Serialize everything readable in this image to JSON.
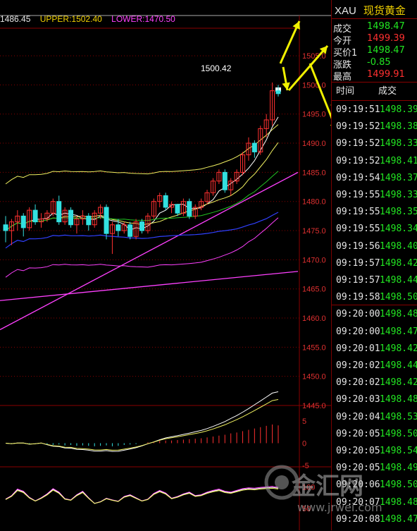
{
  "symbol": {
    "code": "XAU",
    "name": "现货黄金"
  },
  "indicators_bar": {
    "mid": "1486.45",
    "upper": "UPPER:1502.40",
    "lower": "LOWER:1470.50"
  },
  "quote": [
    {
      "label": "成交",
      "value": "1498.47",
      "color": "#22e622"
    },
    {
      "label": "今开",
      "value": "1499.39",
      "color": "#ff3030"
    },
    {
      "label": "买价1",
      "value": "1498.47",
      "color": "#22e622"
    },
    {
      "label": "涨跌",
      "value": "-0.85",
      "color": "#22e622"
    },
    {
      "label": "最高",
      "value": "1499.91",
      "color": "#ff3030"
    }
  ],
  "ticks_header": {
    "time": "时间",
    "price": "成交"
  },
  "ticks": [
    {
      "time": "09:19:51",
      "price": "1498.39"
    },
    {
      "time": "09:19:52",
      "price": "1498.38"
    },
    {
      "time": "09:19:52",
      "price": "1498.33"
    },
    {
      "time": "09:19:52",
      "price": "1498.41"
    },
    {
      "time": "09:19:54",
      "price": "1498.37"
    },
    {
      "time": "09:19:55",
      "price": "1498.33"
    },
    {
      "time": "09:19:55",
      "price": "1498.35"
    },
    {
      "time": "09:19:55",
      "price": "1498.34"
    },
    {
      "time": "09:19:56",
      "price": "1498.40"
    },
    {
      "time": "09:19:57",
      "price": "1498.42"
    },
    {
      "time": "09:19:57",
      "price": "1498.44"
    },
    {
      "time": "09:19:58",
      "price": "1498.50"
    },
    {
      "time": "09:20:00",
      "price": "1498.48"
    },
    {
      "time": "09:20:00",
      "price": "1498.47"
    },
    {
      "time": "09:20:01",
      "price": "1498.42"
    },
    {
      "time": "09:20:02",
      "price": "1498.44"
    },
    {
      "time": "09:20:02",
      "price": "1498.42"
    },
    {
      "time": "09:20:03",
      "price": "1498.48"
    },
    {
      "time": "09:20:04",
      "price": "1498.53"
    },
    {
      "time": "09:20:05",
      "price": "1498.50"
    },
    {
      "time": "09:20:05",
      "price": "1498.54"
    },
    {
      "time": "09:20:05",
      "price": "1498.49"
    },
    {
      "time": "09:20:06",
      "price": "1498.50"
    },
    {
      "time": "09:20:07",
      "price": "1498.48"
    },
    {
      "time": "09:20:08",
      "price": "1498.47"
    }
  ],
  "watermark": {
    "brand": "金汇网",
    "url": "www.jrwei.com"
  },
  "colors": {
    "up": "#ff3030",
    "down": "#33e0e0",
    "grid": "#8a0000",
    "ma5": "#ffffff",
    "ma10": "#f0f060",
    "ma20": "#ff40ff",
    "ma60": "#22c322",
    "ma_long": "#3040ff",
    "arrow": "#f0f000"
  },
  "chart_data": {
    "type": "candlestick",
    "title": "",
    "price_axis": {
      "ylim": [
        1445.0,
        1509.0
      ],
      "ticks": [
        "1505.0",
        "1500.0",
        "1495.0",
        "1490.0",
        "1485.0",
        "1480.0",
        "1475.0",
        "1470.0",
        "1465.0",
        "1460.0",
        "1455.0",
        "1450.0",
        "1445.0"
      ]
    },
    "macd_axis": {
      "ylim": [
        -5,
        8
      ],
      "ticks": [
        "5",
        "0",
        "-5"
      ]
    },
    "kdj_axis": {
      "ylim": [
        0,
        130
      ],
      "ticks": [
        "100",
        "50"
      ]
    },
    "annotation": "1500.42",
    "candles": [
      [
        1476.0,
        1477.5,
        1473.0,
        1475.0
      ],
      [
        1475.0,
        1477.0,
        1472.5,
        1476.5
      ],
      [
        1476.5,
        1478.5,
        1475.0,
        1477.5
      ],
      [
        1477.5,
        1478.0,
        1474.0,
        1475.5
      ],
      [
        1475.5,
        1479.0,
        1475.0,
        1478.5
      ],
      [
        1478.5,
        1479.5,
        1476.0,
        1476.5
      ],
      [
        1476.5,
        1478.0,
        1475.5,
        1477.0
      ],
      [
        1477.0,
        1478.5,
        1476.5,
        1478.0
      ],
      [
        1478.0,
        1480.5,
        1477.5,
        1480.0
      ],
      [
        1480.0,
        1481.0,
        1476.0,
        1476.5
      ],
      [
        1476.5,
        1479.0,
        1476.0,
        1478.5
      ],
      [
        1478.5,
        1479.0,
        1475.5,
        1476.0
      ],
      [
        1476.0,
        1477.5,
        1474.5,
        1477.0
      ],
      [
        1477.0,
        1478.5,
        1476.0,
        1477.5
      ],
      [
        1477.5,
        1478.0,
        1475.0,
        1476.0
      ],
      [
        1476.0,
        1478.5,
        1475.5,
        1478.0
      ],
      [
        1478.0,
        1479.5,
        1477.0,
        1479.0
      ],
      [
        1479.0,
        1479.5,
        1473.5,
        1474.5
      ],
      [
        1474.5,
        1476.5,
        1471.0,
        1476.0
      ],
      [
        1476.0,
        1477.0,
        1474.0,
        1475.0
      ],
      [
        1475.0,
        1476.5,
        1474.5,
        1476.0
      ],
      [
        1476.0,
        1476.5,
        1473.5,
        1474.0
      ],
      [
        1474.0,
        1477.0,
        1473.5,
        1476.5
      ],
      [
        1476.5,
        1477.0,
        1474.5,
        1475.0
      ],
      [
        1475.0,
        1478.0,
        1474.5,
        1477.5
      ],
      [
        1477.5,
        1480.5,
        1477.0,
        1480.0
      ],
      [
        1480.0,
        1481.5,
        1479.0,
        1481.0
      ],
      [
        1481.0,
        1481.5,
        1478.5,
        1479.0
      ],
      [
        1479.0,
        1480.0,
        1478.0,
        1479.5
      ],
      [
        1479.5,
        1479.5,
        1477.5,
        1478.0
      ],
      [
        1478.0,
        1480.5,
        1477.5,
        1480.0
      ],
      [
        1480.0,
        1480.5,
        1477.0,
        1477.5
      ],
      [
        1477.5,
        1479.5,
        1477.0,
        1479.0
      ],
      [
        1479.0,
        1480.5,
        1478.5,
        1480.0
      ],
      [
        1480.0,
        1482.0,
        1479.5,
        1481.5
      ],
      [
        1481.5,
        1484.0,
        1481.0,
        1483.5
      ],
      [
        1483.5,
        1485.5,
        1483.0,
        1485.0
      ],
      [
        1485.0,
        1485.5,
        1481.5,
        1482.0
      ],
      [
        1482.0,
        1484.0,
        1481.0,
        1483.5
      ],
      [
        1483.5,
        1485.5,
        1483.0,
        1485.0
      ],
      [
        1485.0,
        1488.5,
        1484.5,
        1488.0
      ],
      [
        1488.0,
        1491.0,
        1487.0,
        1490.0
      ],
      [
        1490.0,
        1490.5,
        1487.5,
        1488.5
      ],
      [
        1488.5,
        1493.0,
        1488.0,
        1492.5
      ],
      [
        1492.5,
        1495.0,
        1491.0,
        1494.0
      ],
      [
        1494.0,
        1500.4,
        1493.0,
        1499.0
      ],
      [
        1499.0,
        1500.0,
        1498.0,
        1498.5
      ]
    ],
    "macd_bars": [
      0.0,
      -0.1,
      0.1,
      0.0,
      -0.2,
      0.0,
      0.1,
      -0.3,
      -0.4,
      -0.3,
      -0.5,
      -0.4,
      -0.6,
      -0.5,
      -0.6,
      -0.7,
      -0.6,
      -0.5,
      -0.7,
      -0.6,
      -0.4,
      -0.3,
      -0.2,
      0.0,
      0.2,
      0.3,
      0.5,
      0.6,
      0.6,
      0.7,
      0.8,
      0.9,
      1.0,
      1.1,
      1.3,
      1.5,
      1.7,
      1.9,
      2.2,
      2.4,
      2.7,
      3.0,
      3.3,
      3.6,
      3.9,
      4.2,
      4.0
    ],
    "kdj_k": [
      72,
      80,
      95,
      90,
      76,
      68,
      75,
      84,
      96,
      88,
      73,
      70,
      82,
      90,
      75,
      62,
      66,
      74,
      70,
      67,
      78,
      82,
      75,
      68,
      72,
      85,
      92,
      86,
      74,
      78,
      84,
      88,
      80,
      82,
      88,
      92,
      95,
      90,
      88,
      92,
      96,
      98,
      97,
      99,
      100,
      101,
      99
    ]
  }
}
